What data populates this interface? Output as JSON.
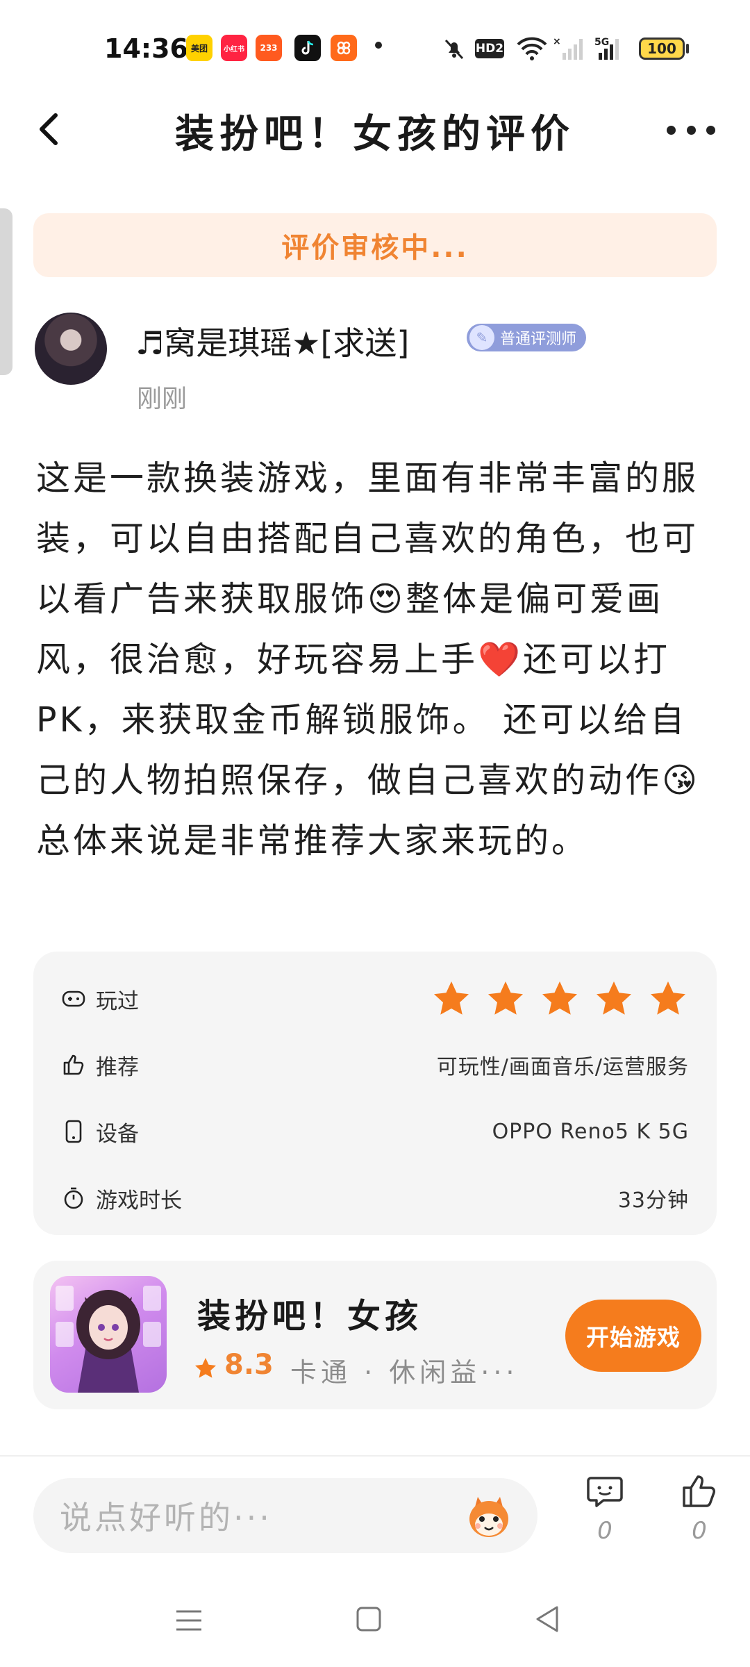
{
  "status_bar": {
    "time": "14:36",
    "apps": [
      {
        "name": "美团",
        "color": "#ffd100",
        "text_color": "#222"
      },
      {
        "name": "小红书",
        "color": "#ff2442",
        "text_color": "#fff"
      },
      {
        "name": "233",
        "color": "#ff5a1f",
        "text_color": "#fff"
      },
      {
        "name": "tiktok-icon",
        "color": "#111111",
        "text_color": "#fff"
      },
      {
        "name": "app-icon",
        "color": "#ff6a1a",
        "text_color": "#fff"
      }
    ],
    "hd_label": "HD2",
    "network_label": "5G",
    "battery": "100"
  },
  "header": {
    "title": "装扮吧！女孩的评价"
  },
  "review_status": "评价审核中...",
  "user": {
    "name": "♬窝是琪瑶★[求送]",
    "badge": "普通评测师",
    "time": "刚刚"
  },
  "review": {
    "body": "这是一款换装游戏，里面有非常丰富的服装，可以自由搭配自己喜欢的角色，也可以看广告来获取服饰😍整体是偏可爱画风，很治愈，好玩容易上手❤️还可以打PK，来获取金币解锁服饰。 还可以给自己的人物拍照保存，做自己喜欢的动作😘总体来说是非常推荐大家来玩的。"
  },
  "info": {
    "played_label": "玩过",
    "rating_stars": 5,
    "recommend_label": "推荐",
    "recommend_value": "可玩性/画面音乐/运营服务",
    "device_label": "设备",
    "device_value": "OPPO Reno5 K 5G",
    "duration_label": "游戏时长",
    "duration_value": "33分钟"
  },
  "game": {
    "name": "装扮吧！女孩",
    "rating": "8.3",
    "tags": "卡通 · 休闲益···",
    "start_button": "开始游戏"
  },
  "bottom": {
    "comment_placeholder": "说点好听的···",
    "comment_count": "0",
    "like_count": "0"
  },
  "colors": {
    "accent": "#f57c1d",
    "banner_bg": "#fff0e6",
    "star": "#f57c1d"
  }
}
